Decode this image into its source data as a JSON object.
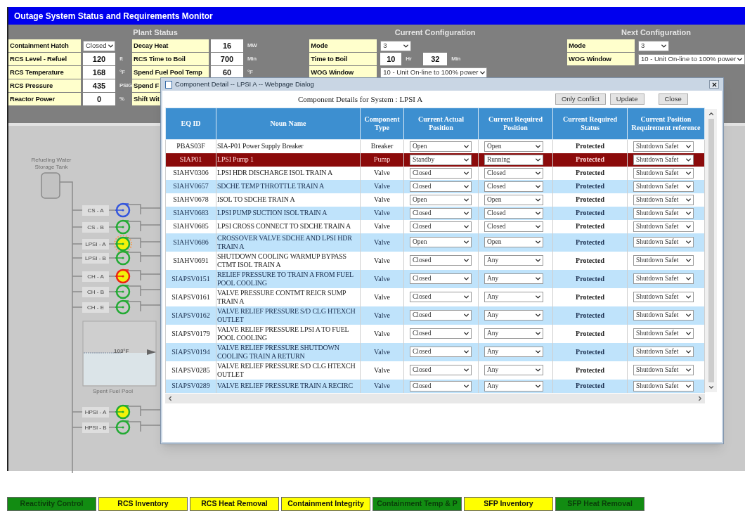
{
  "app": {
    "title": "Outage System Status and Requirements Monitor"
  },
  "plant_status": {
    "title": "Plant Status",
    "left": [
      {
        "label": "Containment Hatch",
        "kind": "select",
        "value": "Closed"
      },
      {
        "label": "RCS Level - Refuel",
        "kind": "number",
        "value": "120",
        "unit": "ft"
      },
      {
        "label": "RCS Temperature",
        "kind": "number",
        "value": "168",
        "unit": "°F"
      },
      {
        "label": "RCS Pressure",
        "kind": "number",
        "value": "435",
        "unit": "PSIG"
      },
      {
        "label": "Reactor Power",
        "kind": "number",
        "value": "0",
        "unit": "%"
      }
    ],
    "right": [
      {
        "label": "Decay Heat",
        "kind": "number",
        "value": "16",
        "unit": "MW"
      },
      {
        "label": "RCS Time to Boil",
        "kind": "number",
        "value": "700",
        "unit": "Min"
      },
      {
        "label": "Spend Fuel Pool Temp",
        "kind": "number",
        "value": "60",
        "unit": "°F"
      },
      {
        "label": "Spend F",
        "kind": "label"
      },
      {
        "label": "Shift Wit",
        "kind": "label"
      }
    ]
  },
  "current_configuration": {
    "title": "Current Configuration",
    "rows": [
      {
        "label": "Mode",
        "kind": "select",
        "value": "3"
      },
      {
        "label": "Time to Boil",
        "kind": "time",
        "hours": "10",
        "hours_unit": "Hr",
        "minutes": "32",
        "minutes_unit": "Min"
      },
      {
        "label": "WOG Window",
        "kind": "select",
        "value": "10 - Unit On-line to 100% power"
      }
    ]
  },
  "next_configuration": {
    "title": "Next Configuration",
    "rows": [
      {
        "label": "Mode",
        "kind": "select",
        "value": "3"
      },
      {
        "label": "WOG Window",
        "kind": "select",
        "value": "10 - Unit On-line to 100% power"
      }
    ]
  },
  "diagram": {
    "tank_label": "Refueling Water Storage Tank",
    "pool_label": "Spent Fuel Pool",
    "pool_temperature": "103°F",
    "pumps": [
      {
        "label": "CS - A",
        "color": "#3355dd",
        "filled": false,
        "alarm": false
      },
      {
        "label": "CS - B",
        "color": "#22aa33",
        "filled": false,
        "alarm": false
      },
      {
        "label": "LPSI - A",
        "color": "#22aa33",
        "filled": true,
        "alarm": true
      },
      {
        "label": "LPSI - B",
        "color": "#22aa33",
        "filled": false,
        "alarm": false
      },
      {
        "label": "CH - A",
        "color": "#ee2211",
        "filled": true,
        "alarm": false
      },
      {
        "label": "CH - B",
        "color": "#22aa33",
        "filled": false,
        "alarm": false
      },
      {
        "label": "CH - E",
        "color": "#22aa33",
        "filled": false,
        "alarm": false
      },
      {
        "label": "HPSI - A",
        "color": "#22aa33",
        "filled": true,
        "alarm": false
      },
      {
        "label": "HPSI - B",
        "color": "#22aa33",
        "filled": false,
        "alarm": false
      }
    ]
  },
  "dialog": {
    "title": "Component Detail -- LPSI A -- Webpage Dialog",
    "heading": "Component Details for System : LPSI A",
    "buttons": [
      "Only Conflict",
      "Update",
      "Close"
    ],
    "columns": [
      "EQ ID",
      "Noun Name",
      "Component Type",
      "Current Actual Position",
      "Current Required Position",
      "Current Required Status",
      "Current Position Requirement reference"
    ],
    "rows": [
      {
        "eq_id": "PBAS03F",
        "noun_name": "SIA-P01 Power Supply Breaker",
        "type": "Breaker",
        "actual": "Open",
        "required": "Open",
        "status": "Protected",
        "reference": "Shutdown Safet",
        "selected": false
      },
      {
        "eq_id": "SIAP01",
        "noun_name": "LPSI Pump 1",
        "type": "Pump",
        "actual": "Standby",
        "required": "Running",
        "status": "Protected",
        "reference": "Shutdown Safet",
        "selected": true
      },
      {
        "eq_id": "SIAHV0306",
        "noun_name": "LPSI HDR DISCHARGE ISOL TRAIN A",
        "type": "Valve",
        "actual": "Closed",
        "required": "Closed",
        "status": "Protected",
        "reference": "Shutdown Safet",
        "selected": false
      },
      {
        "eq_id": "SIAHV0657",
        "noun_name": "SDCHE TEMP THROTTLE TRAIN A",
        "type": "Valve",
        "actual": "Closed",
        "required": "Closed",
        "status": "Protected",
        "reference": "Shutdown Safet",
        "selected": false
      },
      {
        "eq_id": "SIAHV0678",
        "noun_name": "ISOL TO SDCHE TRAIN A",
        "type": "Valve",
        "actual": "Open",
        "required": "Open",
        "status": "Protected",
        "reference": "Shutdown Safet",
        "selected": false
      },
      {
        "eq_id": "SIAHV0683",
        "noun_name": "LPSI PUMP SUCTION ISOL TRAIN A",
        "type": "Valve",
        "actual": "Closed",
        "required": "Closed",
        "status": "Protected",
        "reference": "Shutdown Safet",
        "selected": false
      },
      {
        "eq_id": "SIAHV0685",
        "noun_name": "LPSI CROSS CONNECT TO SDCHE TRAIN A",
        "type": "Valve",
        "actual": "Closed",
        "required": "Closed",
        "status": "Protected",
        "reference": "Shutdown Safet",
        "selected": false
      },
      {
        "eq_id": "SIAHV0686",
        "noun_name": "CROSSOVER VALVE SDCHE AND LPSI HDR TRAIN A",
        "type": "Valve",
        "actual": "Open",
        "required": "Open",
        "status": "Protected",
        "reference": "Shutdown Safet",
        "selected": false
      },
      {
        "eq_id": "SIAHV0691",
        "noun_name": "SHUTDOWN COOLING WARMUP BYPASS CTMT ISOL TRAIN A",
        "type": "Valve",
        "actual": "Closed",
        "required": "Any",
        "status": "Protected",
        "reference": "Shutdown Safet",
        "selected": false
      },
      {
        "eq_id": "SIAPSV0151",
        "noun_name": "RELIEF PRESSURE TO TRAIN A FROM FUEL POOL COOLING",
        "type": "Valve",
        "actual": "Closed",
        "required": "Any",
        "status": "Protected",
        "reference": "Shutdown Safet",
        "selected": false
      },
      {
        "eq_id": "SIAPSV0161",
        "noun_name": "VALVE PRESSURE CONTMT REICR SUMP TRAIN A",
        "type": "Valve",
        "actual": "Closed",
        "required": "Any",
        "status": "Protected",
        "reference": "Shutdown Safet",
        "selected": false
      },
      {
        "eq_id": "SIAPSV0162",
        "noun_name": "VALVE RELIEF PRESSURE S/D CLG HTEXCH OUTLET",
        "type": "Valve",
        "actual": "Closed",
        "required": "Any",
        "status": "Protected",
        "reference": "Shutdown Safet",
        "selected": false
      },
      {
        "eq_id": "SIAPSV0179",
        "noun_name": "VALVE RELIEF PRESSURE LPSI A TO FUEL POOL COOLING",
        "type": "Valve",
        "actual": "Closed",
        "required": "Any",
        "status": "Protected",
        "reference": "Shutdown Safet",
        "selected": false
      },
      {
        "eq_id": "SIAPSV0194",
        "noun_name": "VALVE RELIEF PRESSURE SHUTDOWN COOLING TRAIN A RETURN",
        "type": "Valve",
        "actual": "Closed",
        "required": "Any",
        "status": "Protected",
        "reference": "Shutdown Safet",
        "selected": false
      },
      {
        "eq_id": "SIAPSV0285",
        "noun_name": "VALVE RELIEF PRESSURE S/D CLG HTEXCH OUTLET",
        "type": "Valve",
        "actual": "Closed",
        "required": "Any",
        "status": "Protected",
        "reference": "Shutdown Safet",
        "selected": false
      },
      {
        "eq_id": "SIAPSV0289",
        "noun_name": "VALVE RELIEF PRESSURE TRAIN A RECIRC",
        "type": "Valve",
        "actual": "Closed",
        "required": "Any",
        "status": "Protected",
        "reference": "Shutdown Safet",
        "selected": false
      }
    ]
  },
  "function_tabs": [
    {
      "label": "Reactivity Control",
      "color": "#128c12"
    },
    {
      "label": "RCS Inventory",
      "color": "#ffff00"
    },
    {
      "label": "RCS Heat Removal",
      "color": "#ffff00"
    },
    {
      "label": "Containment Integrity",
      "color": "#ffff00"
    },
    {
      "label": "Containment Temp & P",
      "color": "#128c12"
    },
    {
      "label": "SFP Inventory",
      "color": "#ffff00"
    },
    {
      "label": "SFP Heat Removal",
      "color": "#128c12"
    }
  ]
}
